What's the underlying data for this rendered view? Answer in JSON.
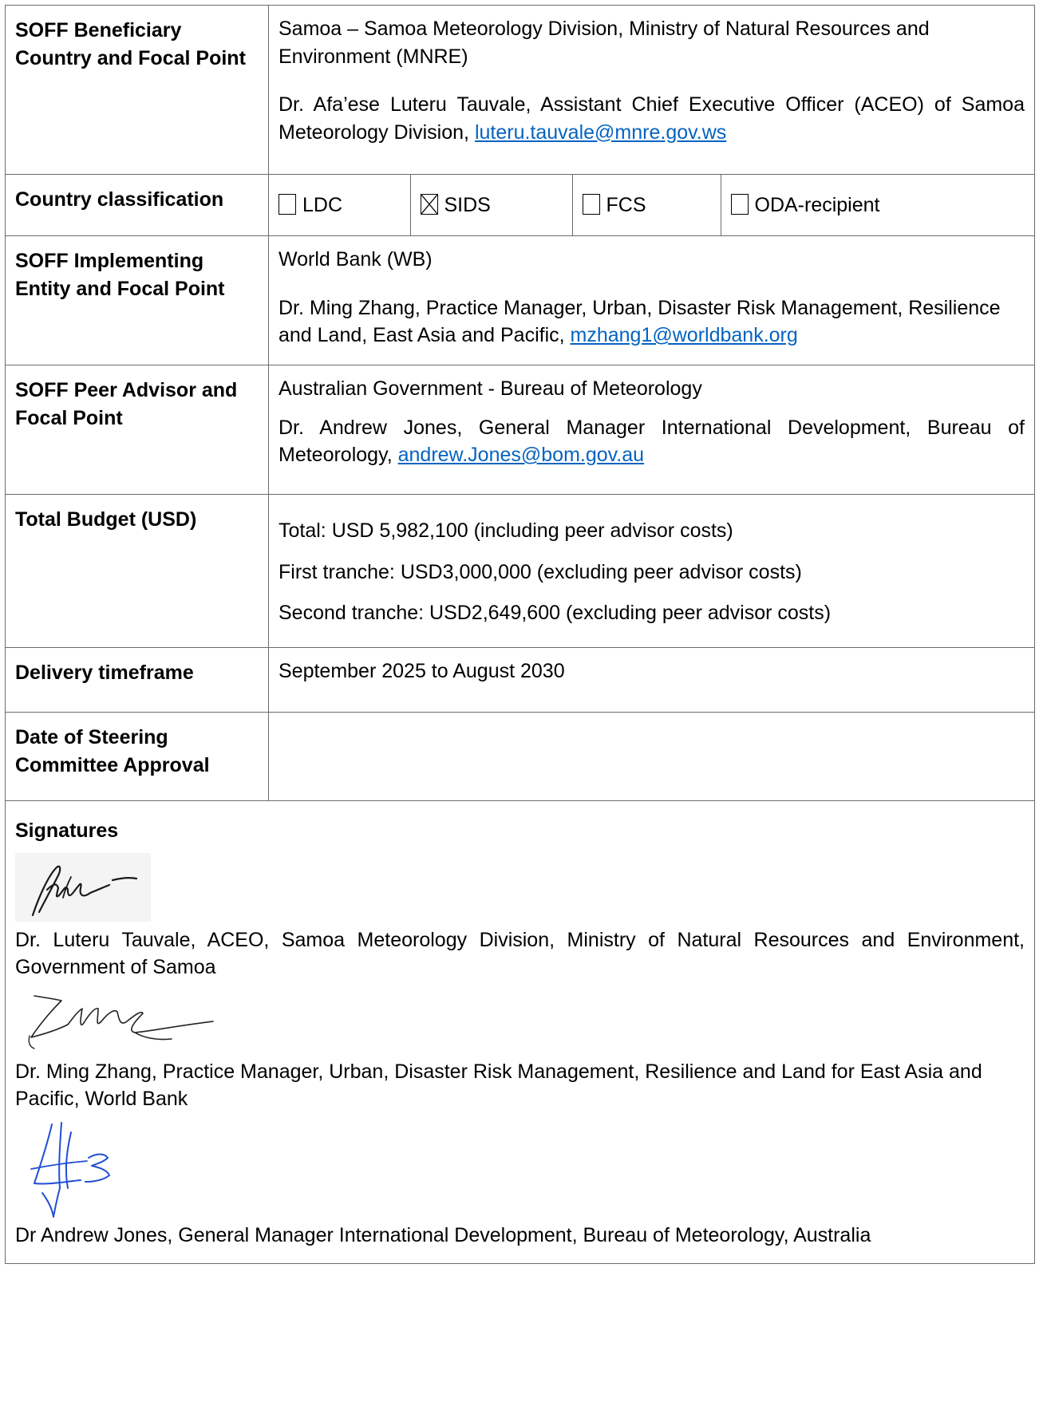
{
  "rows": {
    "beneficiary": {
      "label": "SOFF Beneficiary Country and Focal Point",
      "line1": "Samoa – Samoa Meteorology Division, Ministry of Natural Resources and Environment (MNRE)",
      "line2_text": "Dr. Afa’ese Luteru Tauvale, Assistant Chief Executive Officer (ACEO) of Samoa Meteorology Division, ",
      "line2_email": "luteru.tauvale@mnre.gov.ws"
    },
    "classification": {
      "label": "Country classification",
      "options": [
        {
          "label": "LDC",
          "checked": false
        },
        {
          "label": "SIDS",
          "checked": true
        },
        {
          "label": "FCS",
          "checked": false
        },
        {
          "label": "ODA-recipient",
          "checked": false
        }
      ]
    },
    "implementing": {
      "label": "SOFF Implementing Entity and Focal Point",
      "line1": "World Bank (WB)",
      "line2_text": "Dr. Ming Zhang, Practice Manager, Urban, Disaster Risk Management, Resilience and Land, East Asia and Pacific, ",
      "line2_email": "mzhang1@worldbank.org"
    },
    "peer": {
      "label": "SOFF Peer Advisor and Focal Point",
      "line1": "Australian Government - Bureau of Meteorology",
      "line2_text": "Dr. Andrew Jones, General Manager International Development, Bureau of Meteorology, ",
      "line2_email": "andrew.Jones@bom.gov.au"
    },
    "budget": {
      "label": "Total Budget (USD)",
      "lines": [
        "Total: USD 5,982,100 (including peer advisor costs)",
        "First tranche: USD3,000,000 (excluding peer advisor costs)",
        "Second tranche: USD2,649,600 (excluding peer advisor costs)"
      ]
    },
    "timeframe": {
      "label": "Delivery timeframe",
      "value": "September 2025 to August 2030"
    },
    "approval": {
      "label": "Date of Steering Committee Approval",
      "value": ""
    }
  },
  "signatures": {
    "heading": "Signatures",
    "signer1": "Dr. Luteru Tauvale, ACEO, Samoa Meteorology Division, Ministry of Natural Resources and Environment, Government of Samoa",
    "signer2": "Dr. Ming Zhang, Practice Manager, Urban, Disaster Risk Management, Resilience and Land for East Asia and Pacific, World Bank",
    "signer3": "Dr Andrew Jones, General Manager International Development, Bureau of Meteorology, Australia"
  },
  "colors": {
    "link": "#0563c1",
    "border": "#6b6b6b",
    "signature_blue": "#1f4fd6"
  }
}
